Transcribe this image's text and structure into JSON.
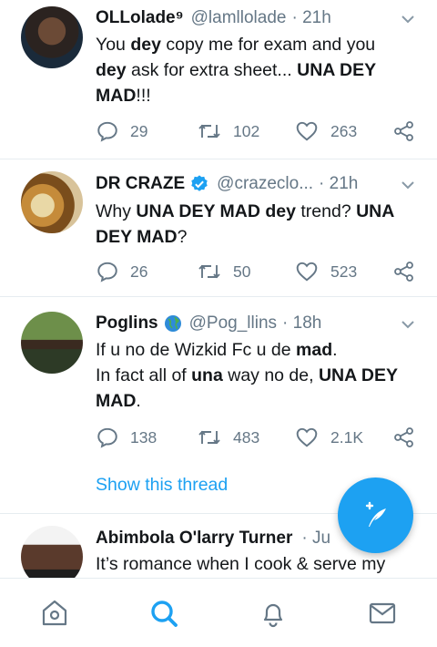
{
  "tweets": [
    {
      "name": "OLLolade⁹",
      "handle": "@lamllolade",
      "time": "· 21h",
      "verified": false,
      "lines": [
        [
          {
            "t": "You "
          },
          {
            "t": "dey",
            "b": true
          },
          {
            "t": " copy me for exam and you"
          }
        ],
        [
          {
            "t": "dey",
            "b": true
          },
          {
            "t": " ask for extra sheet... "
          },
          {
            "t": "UNA DEY",
            "b": true
          }
        ],
        [
          {
            "t": "MAD",
            "b": true
          },
          {
            "t": "!!!"
          }
        ]
      ],
      "replies": "29",
      "retweets": "102",
      "likes": "263"
    },
    {
      "name": "DR CRAZE",
      "handle": "@crazeclo...",
      "time": "· 21h",
      "verified": true,
      "lines": [
        [
          {
            "t": "Why "
          },
          {
            "t": "UNA DEY MAD dey",
            "b": true
          },
          {
            "t": " trend? "
          },
          {
            "t": "UNA",
            "b": true
          }
        ],
        [
          {
            "t": "DEY MAD",
            "b": true
          },
          {
            "t": "?"
          }
        ]
      ],
      "replies": "26",
      "retweets": "50",
      "likes": "523"
    },
    {
      "name": "Poglins",
      "handle": "@Pog_llins",
      "time": "· 18h",
      "verified": false,
      "globe": true,
      "lines": [
        [
          {
            "t": "If u no de Wizkid Fc u de "
          },
          {
            "t": "mad",
            "b": true
          },
          {
            "t": "."
          }
        ],
        [
          {
            "t": "In fact all of "
          },
          {
            "t": "una",
            "b": true
          },
          {
            "t": " way no de, "
          },
          {
            "t": "UNA DEY",
            "b": true
          }
        ],
        [
          {
            "t": "MAD",
            "b": true
          },
          {
            "t": "."
          }
        ]
      ],
      "replies": "138",
      "retweets": "483",
      "likes": "2.1K",
      "thread_link": "Show this thread"
    },
    {
      "name": "Abimbola O'larry Turner",
      "handle": "",
      "time": "· Ju",
      "verified": false,
      "lines": [
        [
          {
            "t": "It’s romance when I cook & serve my"
          }
        ]
      ]
    }
  ],
  "icons": {
    "reply": "reply-icon",
    "retweet": "retweet-icon",
    "like": "heart-icon",
    "share": "share-icon",
    "caret": "chevron-down-icon",
    "compose": "compose-icon",
    "verified": "verified-badge-icon",
    "globe": "globe-emoji-icon"
  },
  "nav": [
    {
      "id": "home",
      "icon": "home-icon",
      "active": false
    },
    {
      "id": "search",
      "icon": "search-icon",
      "active": true
    },
    {
      "id": "notifications",
      "icon": "bell-icon",
      "active": false
    },
    {
      "id": "messages",
      "icon": "mail-icon",
      "active": false
    }
  ],
  "colors": {
    "accent": "#1da1f2",
    "text": "#14171a",
    "muted": "#657786",
    "divider": "#e6ecf0"
  }
}
